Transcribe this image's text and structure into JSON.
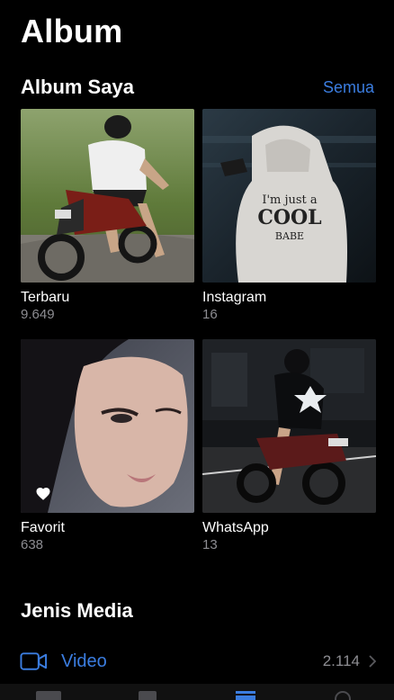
{
  "header": {
    "title": "Album"
  },
  "my_albums": {
    "title": "Album Saya",
    "see_all": "Semua",
    "albums": [
      {
        "name": "Terbaru",
        "count": "9.649"
      },
      {
        "name": "Instagram",
        "count": "16"
      },
      {
        "name": "Favorit",
        "count": "638"
      },
      {
        "name": "WhatsApp",
        "count": "13"
      }
    ]
  },
  "media_types": {
    "title": "Jenis Media",
    "items": [
      {
        "label": "Video",
        "count": "2.114",
        "icon": "video-icon"
      }
    ]
  },
  "colors": {
    "accent": "#3b7de0",
    "secondary_text": "#8d8d92",
    "background": "#000000"
  }
}
